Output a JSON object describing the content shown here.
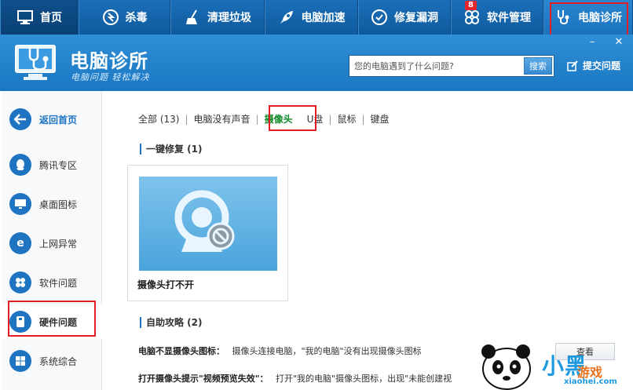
{
  "topnav": {
    "tabs": [
      {
        "label": "首页",
        "icon": "monitor-icon"
      },
      {
        "label": "杀毒",
        "icon": "antivirus-icon"
      },
      {
        "label": "清理垃圾",
        "icon": "broom-icon"
      },
      {
        "label": "电脑加速",
        "icon": "rocket-icon"
      },
      {
        "label": "修复漏洞",
        "icon": "repair-icon"
      },
      {
        "label": "软件管理",
        "icon": "software-icon",
        "badge": "8"
      },
      {
        "label": "电脑诊所",
        "icon": "stethoscope-icon"
      }
    ]
  },
  "header": {
    "title": "电脑诊所",
    "subtitle": "电脑问题 轻松解决",
    "minimize": "–",
    "close": "✕",
    "search_placeholder": "您的电脑遇到了什么问题?",
    "search_button": "搜索",
    "submit_question": "提交问题"
  },
  "sidebar": {
    "back": "返回首页",
    "items": [
      {
        "label": "腾讯专区",
        "icon": "qq-icon"
      },
      {
        "label": "桌面图标",
        "icon": "desktop-icon"
      },
      {
        "label": "上网异常",
        "icon": "ie-icon"
      },
      {
        "label": "软件问题",
        "icon": "software-problem-icon"
      },
      {
        "label": "硬件问题",
        "icon": "hardware-icon"
      },
      {
        "label": "系统综合",
        "icon": "windows-icon"
      }
    ]
  },
  "filters": [
    {
      "label": "全部 (13)"
    },
    {
      "label": "电脑没有声音"
    },
    {
      "label": "摄像头",
      "selected": true
    },
    {
      "label": "U盘"
    },
    {
      "label": "鼠标"
    },
    {
      "label": "键盘"
    }
  ],
  "sections": {
    "fix_title": "一键修复 (1)",
    "card_caption": "摄像头打不开",
    "guide_title": "自助攻略 (2)"
  },
  "guides": [
    {
      "title": "电脑不显摄像头图标：",
      "text": "摄像头连接电脑，\"我的电脑\"没有出现摄像头图标"
    },
    {
      "title": "打开摄像头提示\"视频预览失效\"：",
      "text": "打开\"我的电脑\"摄像头图标，出现\"未能创建视"
    }
  ],
  "guide_button": "查看",
  "watermark": {
    "text1": "小黑",
    "text2": "游戏",
    "url": "xiaohei.com"
  },
  "colors": {
    "nav": "#1565ad",
    "banner": "#2a86cf",
    "accent": "#1e74c0",
    "selected": "#0e8b2a",
    "highlight": "#e21d24"
  }
}
